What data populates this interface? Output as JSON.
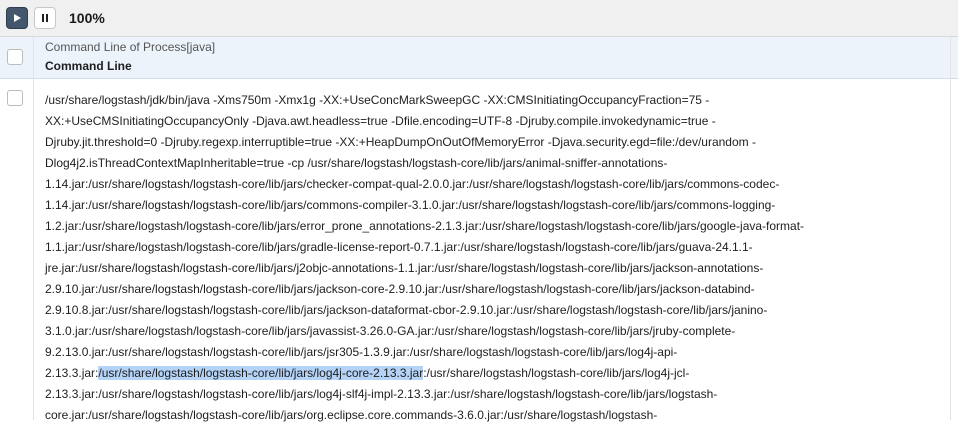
{
  "toolbar": {
    "play_icon": "play-icon",
    "pause_icon": "pause-icon",
    "zoom_level": "100%"
  },
  "table": {
    "header_subtitle": "Command Line of Process[java]",
    "header_title": "Command Line",
    "rows": [
      {
        "lines": [
          "/usr/share/logstash/jdk/bin/java -Xms750m -Xmx1g -XX:+UseConcMarkSweepGC -XX:CMSInitiatingOccupancyFraction=75 -",
          "XX:+UseCMSInitiatingOccupancyOnly -Djava.awt.headless=true -Dfile.encoding=UTF-8 -Djruby.compile.invokedynamic=true -",
          "Djruby.jit.threshold=0 -Djruby.regexp.interruptible=true -XX:+HeapDumpOnOutOfMemoryError -Djava.security.egd=file:/dev/urandom -",
          "Dlog4j2.isThreadContextMapInheritable=true -cp /usr/share/logstash/logstash-core/lib/jars/animal-sniffer-annotations-",
          "1.14.jar:/usr/share/logstash/logstash-core/lib/jars/checker-compat-qual-2.0.0.jar:/usr/share/logstash/logstash-core/lib/jars/commons-codec-",
          "1.14.jar:/usr/share/logstash/logstash-core/lib/jars/commons-compiler-3.1.0.jar:/usr/share/logstash/logstash-core/lib/jars/commons-logging-",
          "1.2.jar:/usr/share/logstash/logstash-core/lib/jars/error_prone_annotations-2.1.3.jar:/usr/share/logstash/logstash-core/lib/jars/google-java-format-",
          "1.1.jar:/usr/share/logstash/logstash-core/lib/jars/gradle-license-report-0.7.1.jar:/usr/share/logstash/logstash-core/lib/jars/guava-24.1.1-",
          "jre.jar:/usr/share/logstash/logstash-core/lib/jars/j2objc-annotations-1.1.jar:/usr/share/logstash/logstash-core/lib/jars/jackson-annotations-",
          "2.9.10.jar:/usr/share/logstash/logstash-core/lib/jars/jackson-core-2.9.10.jar:/usr/share/logstash/logstash-core/lib/jars/jackson-databind-",
          "2.9.10.8.jar:/usr/share/logstash/logstash-core/lib/jars/jackson-dataformat-cbor-2.9.10.jar:/usr/share/logstash/logstash-core/lib/jars/janino-",
          "3.1.0.jar:/usr/share/logstash/logstash-core/lib/jars/javassist-3.26.0-GA.jar:/usr/share/logstash/logstash-core/lib/jars/jruby-complete-",
          "9.2.13.0.jar:/usr/share/logstash/logstash-core/lib/jars/jsr305-1.3.9.jar:/usr/share/logstash/logstash-core/lib/jars/log4j-api-"
        ],
        "highlight_line": {
          "before": "2.13.3.jar:",
          "selected": "/usr/share/logstash/logstash-core/lib/jars/log4j-core-2.13.3.jar",
          "after": ":/usr/share/logstash/logstash-core/lib/jars/log4j-jcl-"
        },
        "lines_after": [
          "2.13.3.jar:/usr/share/logstash/logstash-core/lib/jars/log4j-slf4j-impl-2.13.3.jar:/usr/share/logstash/logstash-core/lib/jars/logstash-",
          "core.jar:/usr/share/logstash/logstash-core/lib/jars/org.eclipse.core.commands-3.6.0.jar:/usr/share/logstash/logstash-"
        ]
      }
    ]
  },
  "colors": {
    "toolbar_bg": "#f0f0f0",
    "play_button_bg": "#44566c",
    "header_bg": "#edf3fb",
    "selection_highlight": "#b4d3f7"
  }
}
